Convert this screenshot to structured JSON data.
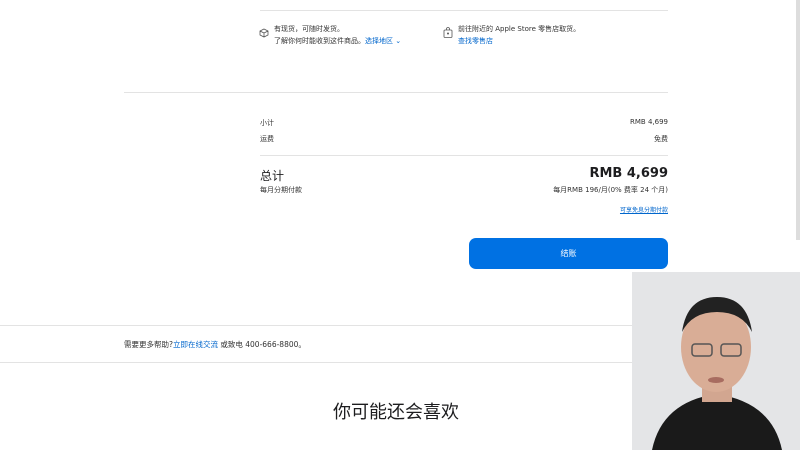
{
  "delivery": {
    "stock_line1": "有现货，可随时发货。",
    "stock_line2": "了解你何时能收到这件商品。",
    "choose_region": "选择地区",
    "pickup_line": "前往附近的 Apple Store 零售店取货。",
    "find_store": "查找零售店"
  },
  "summary": {
    "subtotal_label": "小计",
    "subtotal_value": "RMB 4,699",
    "shipping_label": "运费",
    "shipping_value": "免费",
    "total_label": "总计",
    "total_value": "RMB 4,699",
    "installment_label": "每月分期付款",
    "installment_value": "每月RMB 196/月(0% 费率 24 个月)",
    "installment_link": "可享免息分期付款",
    "checkout_label": "结账"
  },
  "help": {
    "prefix": "需要更多帮助?",
    "chat_link": "立即在线交流",
    "suffix": "或致电 400-666-8800。"
  },
  "recommend_title": "你可能还会喜欢",
  "colors": {
    "accent": "#0071e3",
    "link": "#0066cc"
  }
}
